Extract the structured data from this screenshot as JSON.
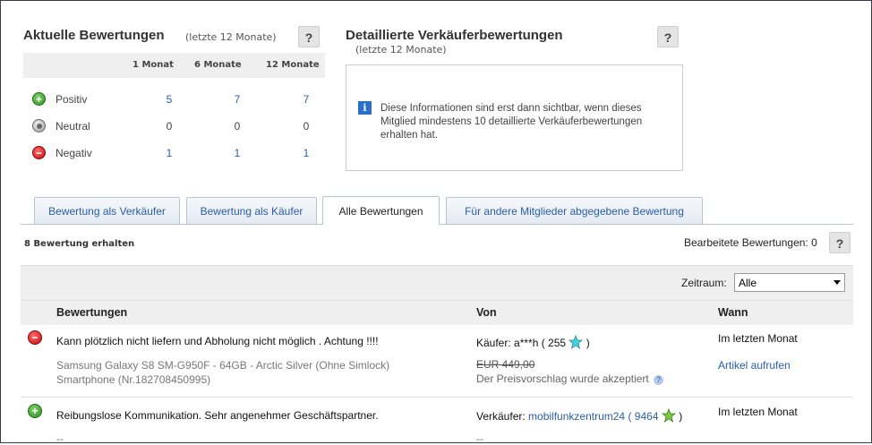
{
  "summary": {
    "title": "Aktuelle Bewertungen",
    "subtitle": "(letzte 12 Monate)",
    "help": "?",
    "columns": [
      "1 Monat",
      "6 Monate",
      "12 Monate"
    ],
    "rows": [
      {
        "label": "Positiv",
        "values": [
          "5",
          "7",
          "7"
        ]
      },
      {
        "label": "Neutral",
        "values": [
          "0",
          "0",
          "0"
        ]
      },
      {
        "label": "Negativ",
        "values": [
          "1",
          "1",
          "1"
        ]
      }
    ]
  },
  "detailed": {
    "title": "Detaillierte Verkäuferbewertungen",
    "subtitle": "(letzte 12 Monate)",
    "help": "?",
    "info_icon": "i",
    "info_text": "Diese Informationen sind erst dann sichtbar, wenn dieses Mitglied mindestens 10 detaillierte Verkäuferbewertungen erhalten hat."
  },
  "tabs": [
    {
      "label": "Bewertung als Verkäufer",
      "active": false
    },
    {
      "label": "Bewertung als Käufer",
      "active": false
    },
    {
      "label": "Alle Bewertungen",
      "active": true
    },
    {
      "label": "Für andere Mitglieder abgegebene Bewertung",
      "active": false
    }
  ],
  "list": {
    "received": "8 Bewertung erhalten",
    "edited_label": "Bearbeitete Bewertungen: 0",
    "help": "?",
    "period_label": "Zeitraum:",
    "period_value": "Alle",
    "headers": {
      "comment": "Bewertungen",
      "from": "Von",
      "when": "Wann"
    },
    "entries": [
      {
        "type": "negativ",
        "comment": "Kann plötzlich nicht liefern und Abholung nicht möglich . Achtung !!!!",
        "item_line1": "Samsung Galaxy S8 SM-G950F - 64GB - Arctic Silver (Ohne Simlock)",
        "item_line2": "Smartphone (Nr.182708450995)",
        "from_prefix": "Käufer: a***h ( 255",
        "from_suffix": ")",
        "price": "EUR 449,00",
        "price_note": "Der Preisvorschlag wurde akzeptiert",
        "when": "Im letzten Monat",
        "action": "Artikel aufrufen"
      },
      {
        "type": "positiv",
        "comment": "Reibungslose Kommunikation. Sehr angenehmer Geschäftspartner.",
        "item_line1": "--",
        "from_prefix": "Verkäufer:",
        "from_user": "mobilfunkzentrum24",
        "from_open": "(",
        "from_score": "9464",
        "from_suffix": ")",
        "price": "--",
        "when": "Im letzten Monat"
      }
    ]
  },
  "colors": {
    "link": "#2a5ea8",
    "positive": "#2f8f22",
    "negative": "#c40c0c",
    "header_bg": "#efefef"
  }
}
